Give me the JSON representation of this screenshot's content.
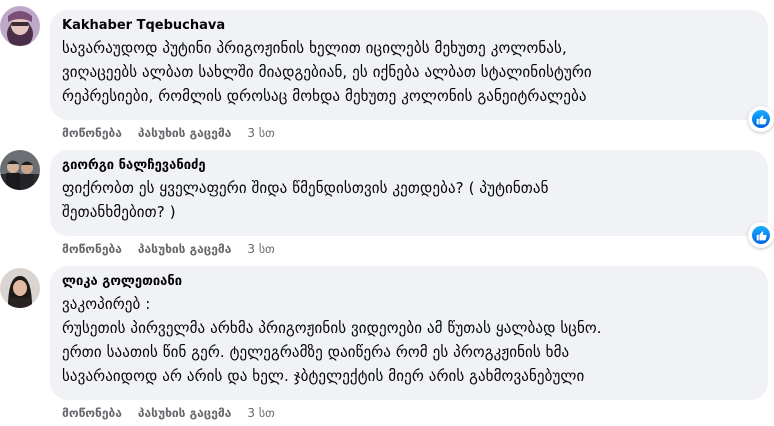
{
  "comments": [
    {
      "author": "Kakhaber Tqebuchava",
      "lines": [
        "სავარაუდოდ პუტინი პრიგოჟინის ხელით იცილებს მეხუთე კოლონას,",
        "ვიღაცეებს ალბათ სახლში მიადგებიან, ეს იქნება ალბათ სტალინისტური",
        "რეპრესიები, რომლის დროსაც მოხდა მეხუთე კოლონის განეიტრალება"
      ],
      "like_label": "მოწონება",
      "reply_label": "პასუხის გაცემა",
      "time": "3 სთ",
      "reaction_icon": "like-icon"
    },
    {
      "author": "გიორგი ნალჩევანიძე",
      "lines": [
        "ფიქრობთ ეს ყველაფერი შიდა წმენდისთვის კეთდება? ( პუტინთან",
        "შეთანხმებით? )"
      ],
      "like_label": "მოწონება",
      "reply_label": "პასუხის გაცემა",
      "time": "3 სთ",
      "reaction_icon": "like-icon"
    },
    {
      "author": "ლიკა გოლეთიანი",
      "lines": [
        "ვაკოპირებ :",
        "რუსეთის პირველმა არხმა პრიგოჟინის ვიდეოები ამ წუთას ყალბად სცნო.",
        "ერთი საათის წინ გერ. ტელეგრამზე დაიწერა რომ ეს პროგკჟინის ხმა",
        "სავარაიდოდ არ არის და ხელ. ჯბტელექტის მიერ არის გახმოვანებული"
      ],
      "like_label": "მოწონება",
      "reply_label": "პასუხის გაცემა",
      "time": "3 სთ"
    }
  ],
  "colors": {
    "bubble": "#f0f2f5",
    "text": "#050505",
    "secondary": "#65676b",
    "like_blue": "#0866ff"
  }
}
